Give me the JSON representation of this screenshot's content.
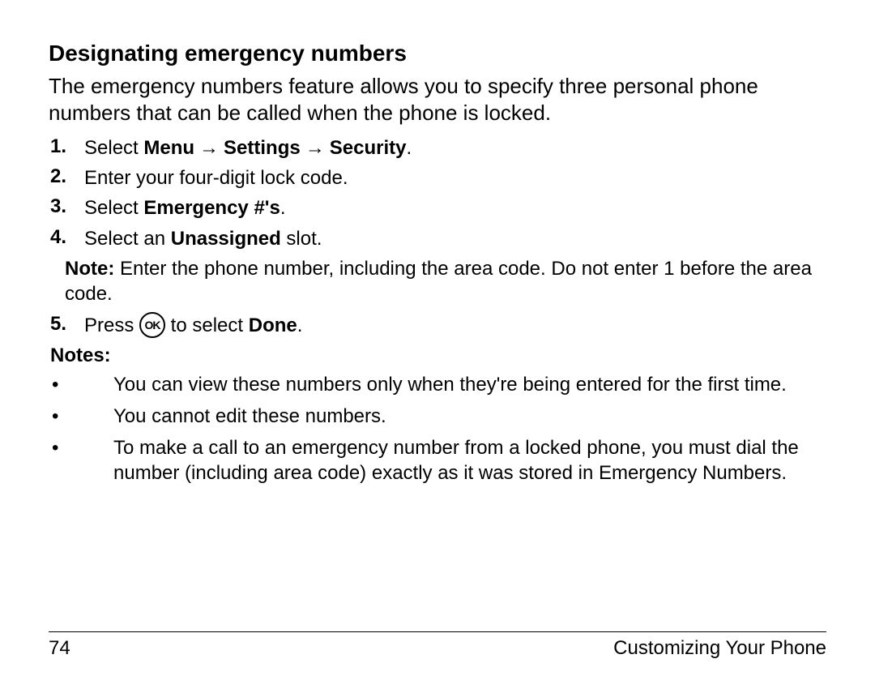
{
  "heading": "Designating emergency numbers",
  "intro": "The emergency numbers feature allows you to specify three personal phone numbers that can be called when the phone is locked.",
  "steps": {
    "s1": {
      "num": "1.",
      "pre": "Select ",
      "menu": "Menu",
      "settings": "Settings",
      "security": "Security",
      "period": "."
    },
    "s2": {
      "num": "2.",
      "text": "Enter your four-digit lock code."
    },
    "s3": {
      "num": "3.",
      "pre": "Select ",
      "bold": "Emergency #'s",
      "post": "."
    },
    "s4": {
      "num": "4.",
      "pre": "Select an ",
      "bold": "Unassigned",
      "post": " slot."
    },
    "note": {
      "label": "Note:",
      "text": " Enter the phone number, including the area code. Do not enter 1 before the area code."
    },
    "s5": {
      "num": "5.",
      "pre": "Press ",
      "icon": "OK",
      "mid": " to select ",
      "bold": "Done",
      "post": "."
    }
  },
  "notes_heading": "Notes:",
  "notes": {
    "n1": "You can view these numbers only when they're being entered for the first time.",
    "n2": "You cannot edit these numbers.",
    "n3": "To make a call to an emergency number from a locked phone, you must dial the number (including area code) exactly as it was stored in Emergency Numbers."
  },
  "arrow_glyph": "→",
  "bullet_glyph": "•",
  "footer": {
    "page": "74",
    "section": "Customizing Your Phone"
  }
}
